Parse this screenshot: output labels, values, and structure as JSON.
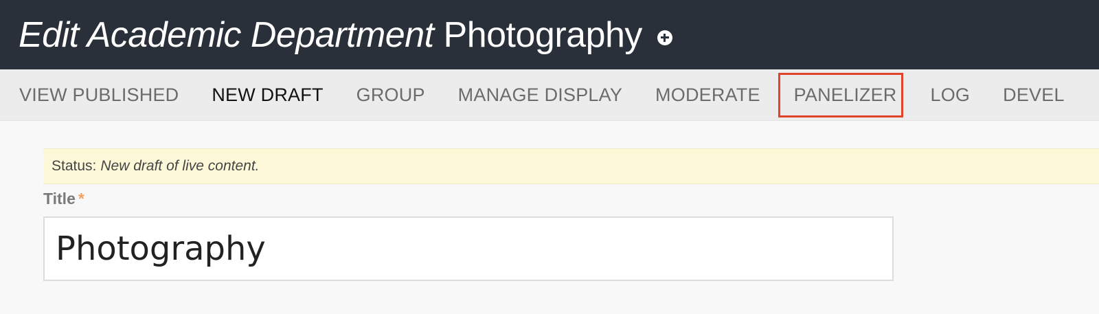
{
  "header": {
    "title_italic": "Edit Academic Department",
    "title_name": "Photography",
    "add_icon": "plus-circle-icon"
  },
  "tabs": [
    {
      "label": "VIEW PUBLISHED",
      "active": false,
      "highlighted": false
    },
    {
      "label": "NEW DRAFT",
      "active": true,
      "highlighted": false
    },
    {
      "label": "GROUP",
      "active": false,
      "highlighted": false
    },
    {
      "label": "MANAGE DISPLAY",
      "active": false,
      "highlighted": false
    },
    {
      "label": "MODERATE",
      "active": false,
      "highlighted": false
    },
    {
      "label": "PANELIZER",
      "active": false,
      "highlighted": true
    },
    {
      "label": "LOG",
      "active": false,
      "highlighted": false
    },
    {
      "label": "DEVEL",
      "active": false,
      "highlighted": false
    }
  ],
  "status": {
    "label": "Status:",
    "value": "New draft of live content."
  },
  "form": {
    "title_label": "Title",
    "required_marker": "*",
    "title_value": "Photography"
  },
  "colors": {
    "header_bg": "#2a3039",
    "highlight_border": "#e0422c",
    "status_bg": "#fdf9d8",
    "required_color": "#f0a35e"
  }
}
